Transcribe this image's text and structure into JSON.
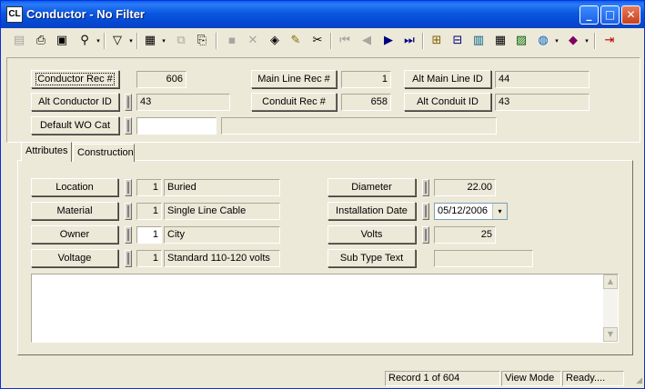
{
  "window": {
    "app_icon": "CL",
    "title": "Conductor - No Filter",
    "controls": {
      "minimize_icon": "minimize-icon",
      "maximize_icon": "maximize-icon",
      "close_icon": "close-icon"
    }
  },
  "toolbar": {
    "icons": [
      "new-record-icon",
      "print-icon",
      "preview-icon",
      "binoculars-icon",
      "filter-icon",
      "report-icon",
      "copy-record-icon",
      "paste-record-icon",
      "save-icon",
      "delete-icon",
      "layers-icon",
      "pencil-icon",
      "scissors-icon",
      "first-record-icon",
      "previous-record-icon",
      "next-record-icon",
      "last-record-icon",
      "related-records-icon",
      "hierarchy-icon",
      "map-icon",
      "calculator-icon",
      "photo-icon",
      "globe-icon",
      "book-icon",
      "exit-icon"
    ],
    "glyphs": {
      "new": "▤",
      "print": "⎙",
      "preview": "▣",
      "find": "⚲",
      "filter": "▽",
      "report": "▦",
      "copy": "⧉",
      "paste": "⎘",
      "save": "▪",
      "delete": "✕",
      "layers": "◈",
      "pencil": "✎",
      "scissors": "✂",
      "first": "⏮",
      "prev": "◀",
      "next": "▶",
      "last": "⏭",
      "related": "⊞",
      "hierarchy": "⊟",
      "map": "▥",
      "calc": "▦",
      "photo": "▨",
      "globe": "◍",
      "book": "◆",
      "exit": "⇥",
      "dropdown": "▾"
    }
  },
  "header": {
    "conductor_rec_label": "Conductor Rec #",
    "conductor_rec_value": "606",
    "main_line_rec_label": "Main Line Rec #",
    "main_line_rec_value": "1",
    "alt_main_line_label": "Alt Main Line ID",
    "alt_main_line_value": "44",
    "alt_conductor_label": "Alt Conductor ID",
    "alt_conductor_value": "43",
    "conduit_rec_label": "Conduit Rec #",
    "conduit_rec_value": "658",
    "alt_conduit_label": "Alt Conduit ID",
    "alt_conduit_value": "43",
    "default_wo_cat_label": "Default WO Cat",
    "default_wo_cat_value": "",
    "default_wo_cat_desc": ""
  },
  "tabs": [
    {
      "label": "Attributes",
      "active": true
    },
    {
      "label": "Construction",
      "active": false
    }
  ],
  "attributes": {
    "left": [
      {
        "label": "Location",
        "code": "1",
        "value": "Buried"
      },
      {
        "label": "Material",
        "code": "1",
        "value": "Single Line Cable"
      },
      {
        "label": "Owner",
        "code": "1",
        "value": "City"
      },
      {
        "label": "Voltage",
        "code": "1",
        "value": "Standard 110-120 volts"
      }
    ],
    "diameter_label": "Diameter",
    "diameter_value": "22.00",
    "installation_date_label": "Installation Date",
    "installation_date_value": "05/12/2006",
    "volts_label": "Volts",
    "volts_value": "25",
    "sub_type_text_label": "Sub Type Text",
    "sub_type_text_value": ""
  },
  "memo": {
    "value": ""
  },
  "status": {
    "record": "Record 1 of 604",
    "mode": "View Mode",
    "state": "Ready...."
  }
}
